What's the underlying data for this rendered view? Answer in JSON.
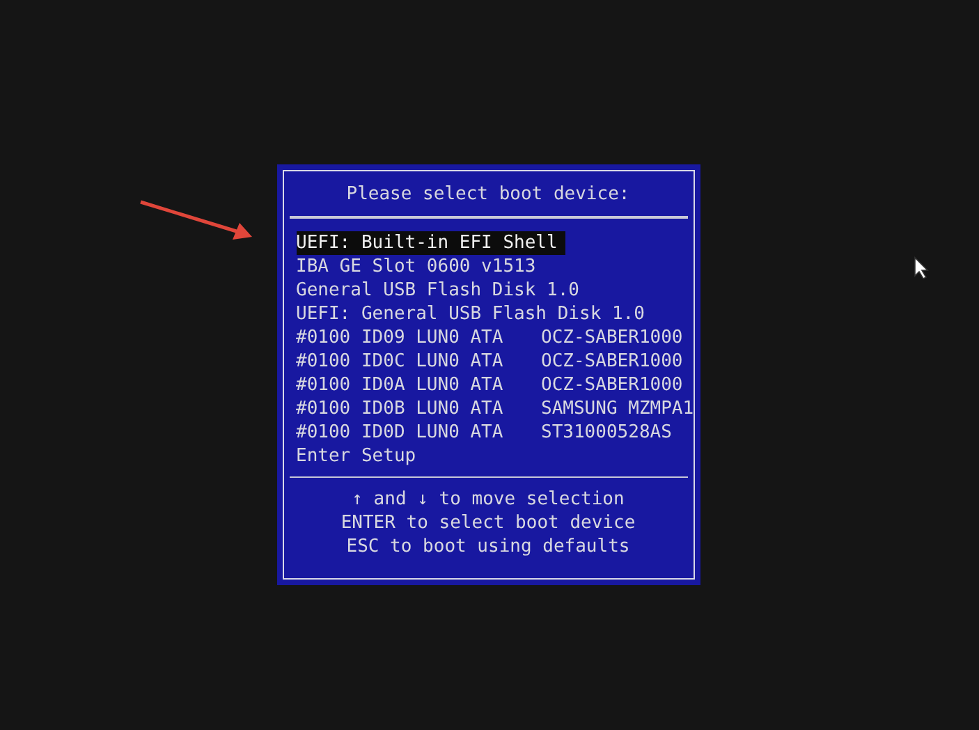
{
  "title": "Please select boot device:",
  "items": [
    {
      "label": "UEFI: Built-in EFI Shell",
      "selected": true
    },
    {
      "label": "IBA GE Slot 0600 v1513",
      "selected": false
    },
    {
      "label": "General USB Flash Disk 1.0",
      "selected": false
    },
    {
      "label": "UEFI: General USB Flash Disk 1.0",
      "selected": false
    },
    {
      "label": "#0100 ID09 LUN0 ATA",
      "device": "OCZ-SABER1000",
      "selected": false
    },
    {
      "label": "#0100 ID0C LUN0 ATA",
      "device": "OCZ-SABER1000",
      "selected": false
    },
    {
      "label": "#0100 ID0A LUN0 ATA",
      "device": "OCZ-SABER1000",
      "selected": false
    },
    {
      "label": "#0100 ID0B LUN0 ATA",
      "device": "SAMSUNG MZMPA1",
      "selected": false
    },
    {
      "label": "#0100 ID0D LUN0 ATA",
      "device": "ST31000528AS",
      "selected": false
    },
    {
      "label": "Enter Setup",
      "selected": false
    }
  ],
  "help": [
    "↑ and ↓ to move selection",
    "ENTER to select boot device",
    "ESC to boot using defaults"
  ]
}
